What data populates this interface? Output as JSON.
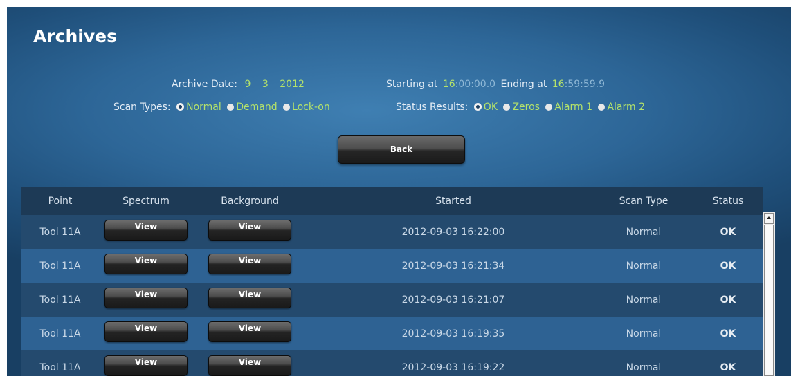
{
  "title": "Archives",
  "archive": {
    "label": "Archive Date:",
    "month": "9",
    "day": "3",
    "year": "2012",
    "starting_label": "Starting at",
    "start_hour": "16",
    "start_rest": ":00:00.0",
    "ending_label": "Ending at",
    "end_hour": "16",
    "end_rest": ":59:59.9"
  },
  "scan_types": {
    "label": "Scan Types:",
    "options": [
      "Normal",
      "Demand",
      "Lock-on"
    ],
    "selected": "Normal"
  },
  "status_results": {
    "label": "Status Results:",
    "options": [
      "OK",
      "Zeros",
      "Alarm 1",
      "Alarm 2"
    ],
    "selected": "OK"
  },
  "back_label": "Back",
  "table": {
    "headers": {
      "point": "Point",
      "spectrum": "Spectrum",
      "background": "Background",
      "started": "Started",
      "scan_type": "Scan Type",
      "status": "Status"
    },
    "view_label": "View",
    "rows": [
      {
        "point": "Tool 11A",
        "started": "2012-09-03 16:22:00",
        "scan_type": "Normal",
        "status": "OK"
      },
      {
        "point": "Tool 11A",
        "started": "2012-09-03 16:21:34",
        "scan_type": "Normal",
        "status": "OK"
      },
      {
        "point": "Tool 11A",
        "started": "2012-09-03 16:21:07",
        "scan_type": "Normal",
        "status": "OK"
      },
      {
        "point": "Tool 11A",
        "started": "2012-09-03 16:19:35",
        "scan_type": "Normal",
        "status": "OK"
      },
      {
        "point": "Tool 11A",
        "started": "2012-09-03 16:19:22",
        "scan_type": "Normal",
        "status": "OK"
      }
    ]
  },
  "colors": {
    "accent_value": "#b5e36a",
    "panel_blue": "#2d6697",
    "header_bg": "#1d3a56"
  }
}
